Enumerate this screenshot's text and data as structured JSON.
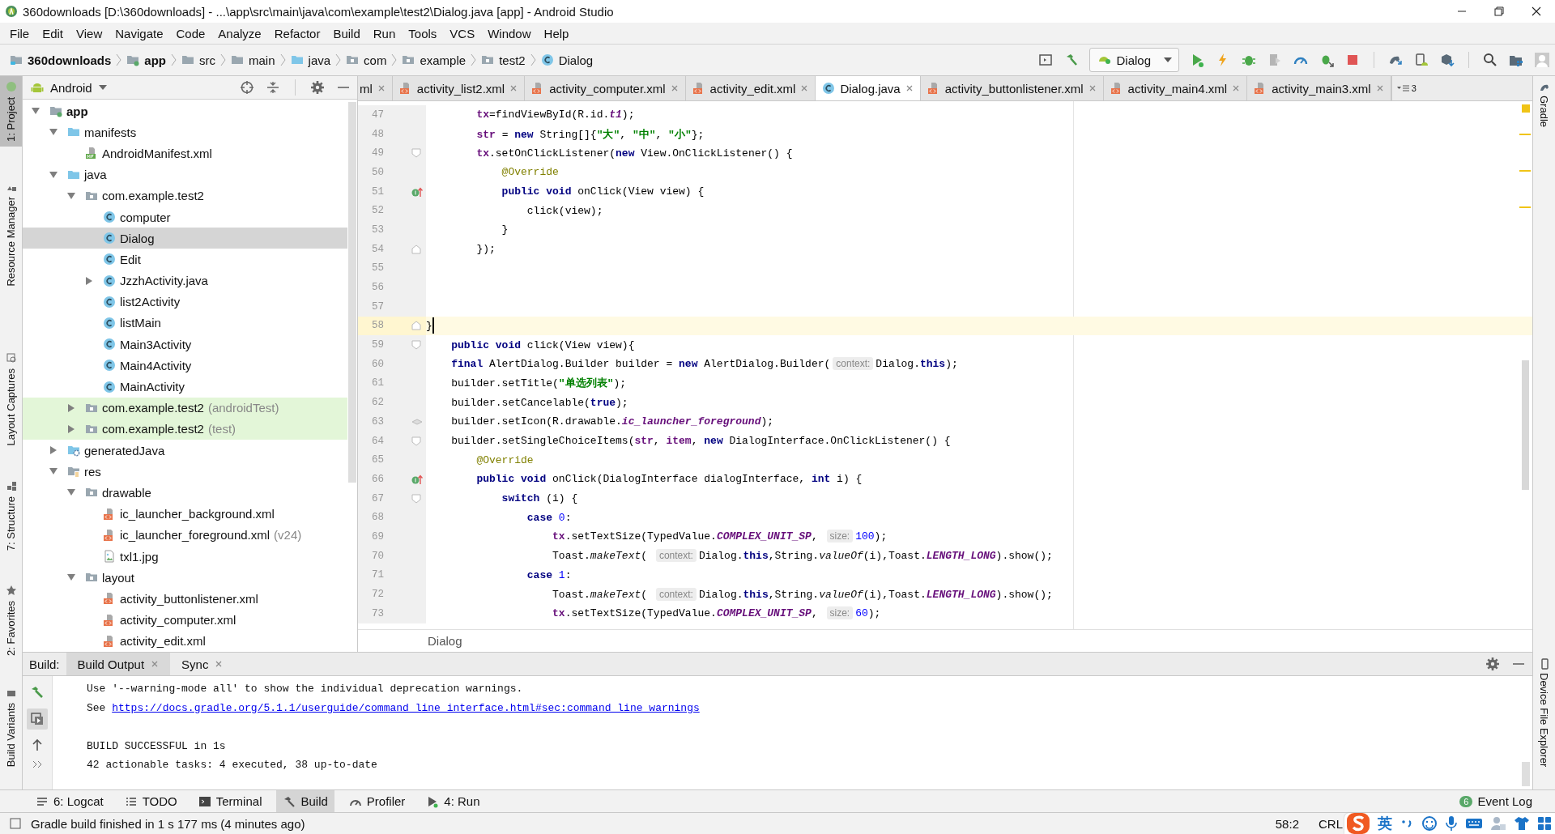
{
  "window": {
    "title": "360downloads [D:\\360downloads] - ...\\app\\src\\main\\java\\com\\example\\test2\\Dialog.java [app] - Android Studio"
  },
  "menu": [
    "File",
    "Edit",
    "View",
    "Navigate",
    "Code",
    "Analyze",
    "Refactor",
    "Build",
    "Run",
    "Tools",
    "VCS",
    "Window",
    "Help"
  ],
  "navigation_bar": {
    "crumbs": [
      {
        "label": "360downloads",
        "kind": "project"
      },
      {
        "label": "app",
        "kind": "module"
      },
      {
        "label": "src",
        "kind": "folder"
      },
      {
        "label": "main",
        "kind": "folder"
      },
      {
        "label": "java",
        "kind": "source"
      },
      {
        "label": "com",
        "kind": "package"
      },
      {
        "label": "example",
        "kind": "package"
      },
      {
        "label": "test2",
        "kind": "package"
      },
      {
        "label": "Dialog",
        "kind": "class"
      }
    ],
    "run_configuration": "Dialog"
  },
  "left_tool_strip": [
    {
      "label": "1: Project",
      "selected": true
    },
    {
      "label": "Resource Manager",
      "selected": false
    },
    {
      "label": "Layout Captures",
      "selected": false
    },
    {
      "label": "7: Structure",
      "selected": false
    },
    {
      "label": "2: Favorites",
      "selected": false
    },
    {
      "label": "Build Variants",
      "selected": false
    }
  ],
  "project_panel": {
    "view": "Android",
    "tree": [
      {
        "label": "app",
        "kind": "module",
        "expanded": true,
        "selected": false,
        "children": [
          {
            "label": "manifests",
            "kind": "source",
            "expanded": true,
            "selected": false,
            "children": [
              {
                "label": "AndroidManifest.xml",
                "kind": "manifest",
                "selected": false
              }
            ]
          },
          {
            "label": "java",
            "kind": "source",
            "expanded": true,
            "selected": false,
            "children": [
              {
                "label": "com.example.test2",
                "kind": "package",
                "expanded": true,
                "selected": false,
                "children": [
                  {
                    "label": "computer",
                    "kind": "class",
                    "selected": false
                  },
                  {
                    "label": "Dialog",
                    "kind": "class",
                    "selected": true
                  },
                  {
                    "label": "Edit",
                    "kind": "class",
                    "selected": false
                  },
                  {
                    "label": "JzzhActivity.java",
                    "kind": "class",
                    "expanded": false,
                    "selected": false
                  },
                  {
                    "label": "list2Activity",
                    "kind": "class",
                    "selected": false
                  },
                  {
                    "label": "listMain",
                    "kind": "class",
                    "selected": false
                  },
                  {
                    "label": "Main3Activity",
                    "kind": "class",
                    "selected": false
                  },
                  {
                    "label": "Main4Activity",
                    "kind": "class",
                    "selected": false
                  },
                  {
                    "label": "MainActivity",
                    "kind": "class",
                    "selected": false
                  }
                ]
              },
              {
                "label": "com.example.test2",
                "suffix": "(androidTest)",
                "kind": "test-package",
                "expanded": false,
                "selected": false
              },
              {
                "label": "com.example.test2",
                "suffix": "(test)",
                "kind": "test-package",
                "expanded": false,
                "selected": false
              }
            ]
          },
          {
            "label": "generatedJava",
            "kind": "generated",
            "expanded": false,
            "selected": false
          },
          {
            "label": "res",
            "kind": "resources",
            "expanded": true,
            "selected": false,
            "children": [
              {
                "label": "drawable",
                "kind": "package",
                "expanded": true,
                "selected": false,
                "children": [
                  {
                    "label": "ic_launcher_background.xml",
                    "kind": "xml",
                    "selected": false
                  },
                  {
                    "label": "ic_launcher_foreground.xml",
                    "suffix": "(v24)",
                    "kind": "xml",
                    "selected": false
                  },
                  {
                    "label": "txl1.jpg",
                    "kind": "image",
                    "selected": false
                  }
                ]
              },
              {
                "label": "layout",
                "kind": "package",
                "expanded": true,
                "selected": false,
                "children": [
                  {
                    "label": "activity_buttonlistener.xml",
                    "kind": "xml",
                    "selected": false
                  },
                  {
                    "label": "activity_computer.xml",
                    "kind": "xml",
                    "selected": false
                  },
                  {
                    "label": "activity_edit.xml",
                    "kind": "xml",
                    "selected": false
                  }
                ]
              }
            ]
          }
        ]
      }
    ]
  },
  "editor": {
    "tabs": [
      {
        "label": "ml",
        "selected": false
      },
      {
        "label": "activity_list2.xml",
        "kind": "xml",
        "selected": false
      },
      {
        "label": "activity_computer.xml",
        "kind": "xml",
        "selected": false
      },
      {
        "label": "activity_edit.xml",
        "kind": "xml",
        "selected": false
      },
      {
        "label": "Dialog.java",
        "kind": "class",
        "selected": true
      },
      {
        "label": "activity_buttonlistener.xml",
        "kind": "xml",
        "selected": false
      },
      {
        "label": "activity_main4.xml",
        "kind": "xml",
        "selected": false
      },
      {
        "label": "activity_main3.xml",
        "kind": "xml",
        "selected": false
      }
    ],
    "hidden_tabs": "3",
    "lines": [
      {
        "number": "47",
        "current": false,
        "tokens": [
          {
            "kind": "field",
            "text": "        tx"
          },
          {
            "kind": "plain",
            "text": "=findViewById(R.id."
          },
          {
            "kind": "static",
            "text": "t1"
          },
          {
            "kind": "plain",
            "text": ");"
          }
        ]
      },
      {
        "number": "48",
        "current": false,
        "tokens": [
          {
            "kind": "field",
            "text": "        str"
          },
          {
            "kind": "plain",
            "text": " = "
          },
          {
            "kind": "keyword",
            "text": "new"
          },
          {
            "kind": "plain",
            "text": " String[]{"
          },
          {
            "kind": "string",
            "text": "\"大\""
          },
          {
            "kind": "plain",
            "text": ", "
          },
          {
            "kind": "string",
            "text": "\"中\""
          },
          {
            "kind": "plain",
            "text": ", "
          },
          {
            "kind": "string",
            "text": "\"小\""
          },
          {
            "kind": "plain",
            "text": "};"
          }
        ]
      },
      {
        "number": "49",
        "current": false,
        "marker": {
          "kind": "fold"
        },
        "tokens": [
          {
            "kind": "field",
            "text": "        tx"
          },
          {
            "kind": "plain",
            "text": ".setOnClickListener("
          },
          {
            "kind": "keyword",
            "text": "new"
          },
          {
            "kind": "plain",
            "text": " View.OnClickListener() {"
          }
        ]
      },
      {
        "number": "50",
        "current": false,
        "tokens": [
          {
            "kind": "annotation",
            "text": "            @Override"
          }
        ]
      },
      {
        "number": "51",
        "current": false,
        "marker": {
          "kind": "override"
        },
        "tokens": [
          {
            "kind": "keyword",
            "text": "            public void"
          },
          {
            "kind": "plain",
            "text": " onClick(View view) {"
          }
        ]
      },
      {
        "number": "52",
        "current": false,
        "tokens": [
          {
            "kind": "plain",
            "text": "                click(view);"
          }
        ]
      },
      {
        "number": "53",
        "current": false,
        "tokens": [
          {
            "kind": "plain",
            "text": "            }"
          }
        ]
      },
      {
        "number": "54",
        "current": false,
        "marker": {
          "kind": "fold-end"
        },
        "tokens": [
          {
            "kind": "plain",
            "text": "        });"
          }
        ]
      },
      {
        "number": "55",
        "current": false
      },
      {
        "number": "56",
        "current": false
      },
      {
        "number": "57",
        "current": false
      },
      {
        "number": "58",
        "current": true,
        "marker": {
          "kind": "fold-end"
        },
        "tokens": [
          {
            "kind": "plain",
            "text": "}"
          }
        ]
      },
      {
        "number": "59",
        "current": false,
        "marker": {
          "kind": "fold"
        },
        "tokens": [
          {
            "kind": "keyword",
            "text": "    public void"
          },
          {
            "kind": "plain",
            "text": " click(View view){"
          }
        ]
      },
      {
        "number": "60",
        "current": false,
        "tokens": [
          {
            "kind": "keyword",
            "text": "    final"
          },
          {
            "kind": "plain",
            "text": " AlertDialog.Builder builder = "
          },
          {
            "kind": "keyword",
            "text": "new"
          },
          {
            "kind": "plain",
            "text": " AlertDialog.Builder("
          },
          {
            "kind": "hint",
            "text": "context:"
          },
          {
            "kind": "plain",
            "text": "Dialog."
          },
          {
            "kind": "keyword",
            "text": "this"
          },
          {
            "kind": "plain",
            "text": ");"
          }
        ]
      },
      {
        "number": "61",
        "current": false,
        "tokens": [
          {
            "kind": "plain",
            "text": "    builder.setTitle("
          },
          {
            "kind": "string",
            "text": "\"单选列表\""
          },
          {
            "kind": "plain",
            "text": ");"
          }
        ]
      },
      {
        "number": "62",
        "current": false,
        "tokens": [
          {
            "kind": "plain",
            "text": "    builder.setCancelable("
          },
          {
            "kind": "keyword",
            "text": "true"
          },
          {
            "kind": "plain",
            "text": ");"
          }
        ]
      },
      {
        "number": "63",
        "current": false,
        "marker": {
          "kind": "resource"
        },
        "tokens": [
          {
            "kind": "plain",
            "text": "    builder.setIcon(R.drawable."
          },
          {
            "kind": "static",
            "text": "ic_launcher_foreground"
          },
          {
            "kind": "plain",
            "text": ");"
          }
        ]
      },
      {
        "number": "64",
        "current": false,
        "marker": {
          "kind": "fold"
        },
        "tokens": [
          {
            "kind": "plain",
            "text": "    builder.setSingleChoiceItems("
          },
          {
            "kind": "field",
            "text": "str"
          },
          {
            "kind": "plain",
            "text": ", "
          },
          {
            "kind": "field",
            "text": "item"
          },
          {
            "kind": "plain",
            "text": ", "
          },
          {
            "kind": "keyword",
            "text": "new"
          },
          {
            "kind": "plain",
            "text": " DialogInterface.OnClickListener() {"
          }
        ]
      },
      {
        "number": "65",
        "current": false,
        "tokens": [
          {
            "kind": "annotation",
            "text": "        @Override"
          }
        ]
      },
      {
        "number": "66",
        "current": false,
        "marker": {
          "kind": "override"
        },
        "tokens": [
          {
            "kind": "keyword",
            "text": "        public void"
          },
          {
            "kind": "plain",
            "text": " onClick(DialogInterface dialogInterface, "
          },
          {
            "kind": "keyword",
            "text": "int"
          },
          {
            "kind": "plain",
            "text": " i) {"
          }
        ]
      },
      {
        "number": "67",
        "current": false,
        "marker": {
          "kind": "fold"
        },
        "tokens": [
          {
            "kind": "keyword",
            "text": "            switch"
          },
          {
            "kind": "plain",
            "text": " (i) {"
          }
        ]
      },
      {
        "number": "68",
        "current": false,
        "tokens": [
          {
            "kind": "keyword",
            "text": "                case "
          },
          {
            "kind": "number",
            "text": "0"
          },
          {
            "kind": "plain",
            "text": ":"
          }
        ]
      },
      {
        "number": "69",
        "current": false,
        "tokens": [
          {
            "kind": "field",
            "text": "                    tx"
          },
          {
            "kind": "plain",
            "text": ".setTextSize(TypedValue."
          },
          {
            "kind": "static",
            "text": "COMPLEX_UNIT_SP"
          },
          {
            "kind": "plain",
            "text": ", "
          },
          {
            "kind": "hint",
            "text": "size:"
          },
          {
            "kind": "number",
            "text": "100"
          },
          {
            "kind": "plain",
            "text": ");"
          }
        ]
      },
      {
        "number": "70",
        "current": false,
        "tokens": [
          {
            "kind": "plain",
            "text": "                    Toast."
          },
          {
            "kind": "method",
            "text": "makeText"
          },
          {
            "kind": "plain",
            "text": "( "
          },
          {
            "kind": "hint",
            "text": "context:"
          },
          {
            "kind": "plain",
            "text": "Dialog."
          },
          {
            "kind": "keyword",
            "text": "this"
          },
          {
            "kind": "plain",
            "text": ",String."
          },
          {
            "kind": "method",
            "text": "valueOf"
          },
          {
            "kind": "plain",
            "text": "(i),Toast."
          },
          {
            "kind": "static",
            "text": "LENGTH_LONG"
          },
          {
            "kind": "plain",
            "text": ").show();"
          }
        ]
      },
      {
        "number": "71",
        "current": false,
        "tokens": [
          {
            "kind": "keyword",
            "text": "                case "
          },
          {
            "kind": "number",
            "text": "1"
          },
          {
            "kind": "plain",
            "text": ":"
          }
        ]
      },
      {
        "number": "72",
        "current": false,
        "tokens": [
          {
            "kind": "plain",
            "text": "                    Toast."
          },
          {
            "kind": "method",
            "text": "makeText"
          },
          {
            "kind": "plain",
            "text": "( "
          },
          {
            "kind": "hint",
            "text": "context:"
          },
          {
            "kind": "plain",
            "text": "Dialog."
          },
          {
            "kind": "keyword",
            "text": "this"
          },
          {
            "kind": "plain",
            "text": ",String."
          },
          {
            "kind": "method",
            "text": "valueOf"
          },
          {
            "kind": "plain",
            "text": "(i),Toast."
          },
          {
            "kind": "static",
            "text": "LENGTH_LONG"
          },
          {
            "kind": "plain",
            "text": ").show();"
          }
        ]
      },
      {
        "number": "73",
        "current": false,
        "tokens": [
          {
            "kind": "field",
            "text": "                    tx"
          },
          {
            "kind": "plain",
            "text": ".setTextSize(TypedValue."
          },
          {
            "kind": "static",
            "text": "COMPLEX_UNIT_SP"
          },
          {
            "kind": "plain",
            "text": ", "
          },
          {
            "kind": "hint",
            "text": "size:"
          },
          {
            "kind": "number",
            "text": "60"
          },
          {
            "kind": "plain",
            "text": ");"
          }
        ]
      }
    ],
    "breadcrumb": "Dialog"
  },
  "right_tool_strip": [
    {
      "label": "Gradle"
    },
    {
      "label": "Device File Explorer"
    }
  ],
  "build_panel": {
    "title": "Build:",
    "tabs": [
      {
        "label": "Build Output",
        "selected": true
      },
      {
        "label": "Sync",
        "selected": false
      }
    ],
    "output": [
      {
        "text": "Use '--warning-mode all' to show the individual deprecation warnings."
      },
      {
        "text": "See ",
        "link": "https://docs.gradle.org/5.1.1/userguide/command_line_interface.html#sec:command_line_warnings"
      },
      {
        "text": "BUILD SUCCESSFUL in 1s",
        "gap_before": true
      },
      {
        "text": "42 actionable tasks: 4 executed, 38 up-to-date"
      }
    ]
  },
  "tool_windows": [
    {
      "label": "6: Logcat",
      "selected": false
    },
    {
      "label": "TODO",
      "selected": false
    },
    {
      "label": "Terminal",
      "selected": false
    },
    {
      "label": "Build",
      "selected": true
    },
    {
      "label": "Profiler",
      "selected": false
    },
    {
      "label": "4: Run",
      "selected": false
    }
  ],
  "event_log": {
    "label": "Event Log",
    "count": "6"
  },
  "status_bar": {
    "message": "Gradle build finished in 1 s 177 ms (4 minutes ago)",
    "position": "58:2",
    "line_separator": "CRL"
  },
  "input_method": {
    "mode": "英"
  }
}
